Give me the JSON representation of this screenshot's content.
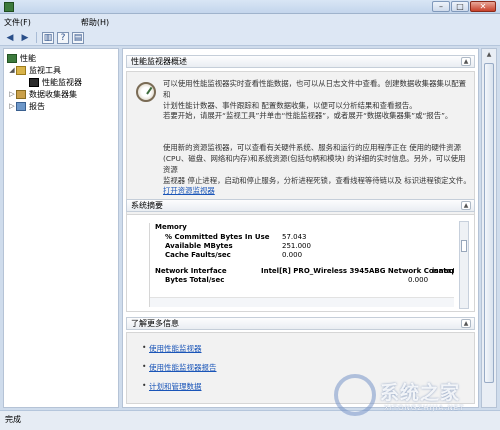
{
  "menubar": {
    "file": "文件(F)",
    "help": "帮助(H)"
  },
  "window_buttons": {
    "minimize": "–",
    "maximize": "□",
    "close": "✕"
  },
  "tree": {
    "root": "性能",
    "tools": "监视工具",
    "monitor": "性能监视器",
    "collector_sets": "数据收集器集",
    "reports": "报告"
  },
  "overview": {
    "title": "性能监视器概述",
    "p1_line1": "可以使用性能监视器实时查看性能数据，也可以从日志文件中查看。创建数据收集器集以配置和",
    "p1_line2": "计划性能计数器、事件跟踪和 配置数据收集，以便可以分析结果和查看报告。",
    "p2": "若要开始，请展开“监视工具”并单击“性能监视器”，或者展开“数据收集器集”或“报告”。",
    "p3_line1": "使用新的资源监视器，可以查看有关硬件系统、服务和运行的应用程序正在 使用的硬件资源",
    "p3_line2": "(CPU、磁盘、网络和内存)和系统资源(包括句柄和模块) 的详细的实时信息。另外，可以使用资源",
    "p3_line3": "监视器 停止进程，启动和停止服务，分析进程死锁，查看线程等待链以及 标识进程锁定文件。",
    "link": "打开资源监视器"
  },
  "summary": {
    "title": "系统摘要",
    "memory_label": "Memory",
    "rows": [
      {
        "name": "% Committed Bytes In Use",
        "value": "57.043"
      },
      {
        "name": "Available MBytes",
        "value": "251.000"
      },
      {
        "name": "Cache Faults/sec",
        "value": "0.000"
      }
    ],
    "network_label": "Network Interface",
    "network_adapter": "Intel[R] PRO_Wireless 3945ABG Network Connection",
    "network_adapter2": "isatap.{40",
    "network_row_name": "Bytes Total/sec",
    "network_row_value": "0.000"
  },
  "learn_more": {
    "title": "了解更多信息",
    "links": [
      "使用性能监视器",
      "使用性能监视器报告",
      "计划和管理数据"
    ]
  },
  "statusbar": {
    "text": "完成"
  },
  "watermark": {
    "brand": "系统之家",
    "url": "XITONGZHIJIA.NET"
  }
}
